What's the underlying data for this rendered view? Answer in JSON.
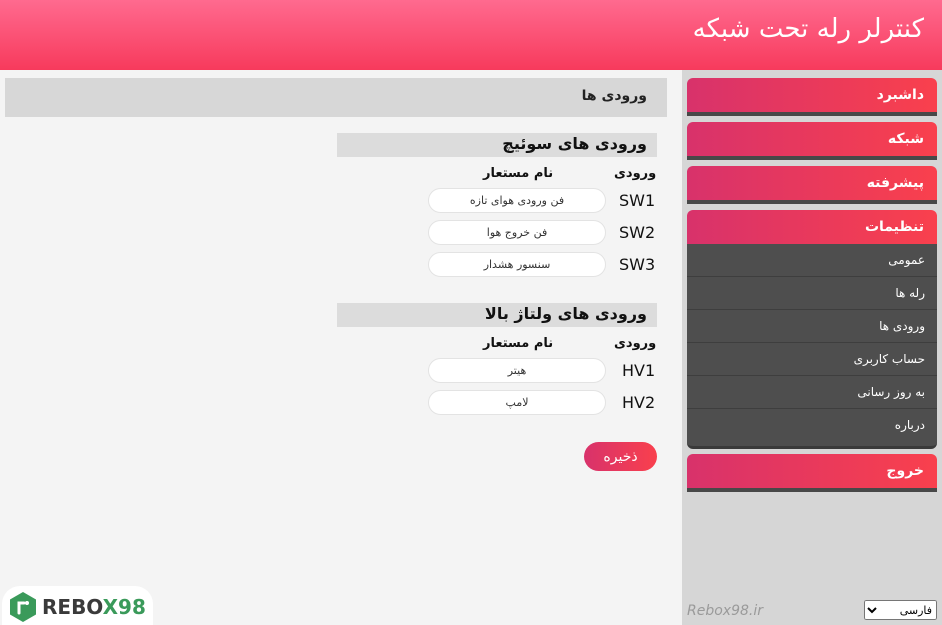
{
  "header": {
    "title": "کنترلر رله تحت شبکه"
  },
  "sidebar": {
    "dashboard": "داشبرد",
    "network": "شبکه",
    "advanced": "پیشرفته",
    "settings": "تنظیمات",
    "submenu": [
      "عمومی",
      "رله ها",
      "ورودی ها",
      "حساب کاربری",
      "به روز رسانی",
      "درباره"
    ],
    "logout": "خروج"
  },
  "footer": {
    "link": "Rebox98.ir",
    "language": {
      "selected": "فارسی"
    }
  },
  "page": {
    "title": "ورودی ها",
    "switch_section": {
      "title": "ورودی های سوئیچ",
      "col_input": "ورودی",
      "col_alias": "نام مستعار",
      "rows": [
        {
          "code": "SW1",
          "alias": "فن ورودی هوای تازه"
        },
        {
          "code": "SW2",
          "alias": "فن خروج هوا"
        },
        {
          "code": "SW3",
          "alias": "سنسور هشدار"
        }
      ]
    },
    "hv_section": {
      "title": "ورودی های ولتاژ بالا",
      "col_input": "ورودی",
      "col_alias": "نام مستعار",
      "rows": [
        {
          "code": "HV1",
          "alias": "هیتر"
        },
        {
          "code": "HV2",
          "alias": "لامپ"
        }
      ]
    },
    "save": "ذخیره"
  },
  "logo": {
    "text_a": "REBO",
    "text_b": "X98",
    "accent": "#3a9a5a"
  },
  "colors": {
    "header": "#f73a5c",
    "button": "#f9404d",
    "submenu": "#4e4e4e"
  }
}
